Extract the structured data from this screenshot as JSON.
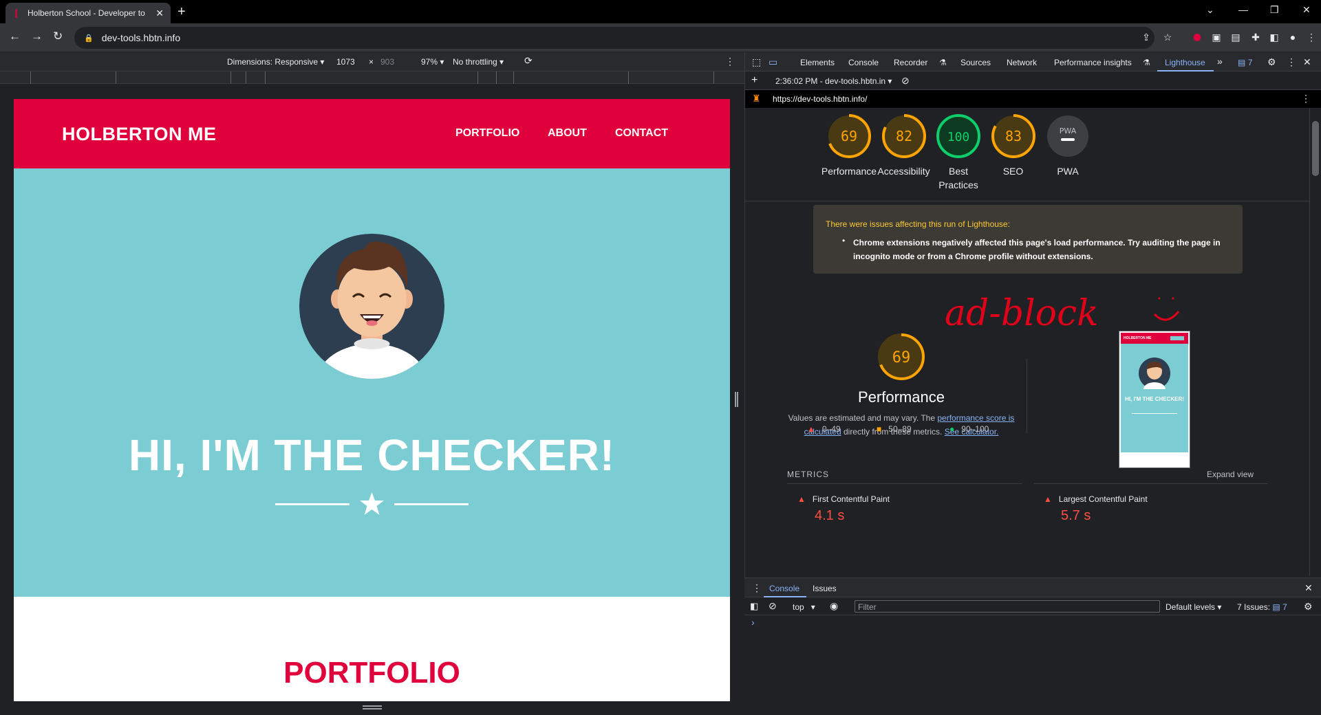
{
  "browser": {
    "tab_title": "Holberton School - Developer to",
    "tab_close": "✕",
    "new_tab": "+",
    "url": "dev-tools.hbtn.info"
  },
  "device_toolbar": {
    "dimensions_label": "Dimensions: Responsive",
    "width": "1073",
    "times": "×",
    "height": "903",
    "zoom": "97%",
    "throttling": "No throttling"
  },
  "page": {
    "brand": "HOLBERTON ME",
    "nav": [
      "PORTFOLIO",
      "ABOUT",
      "CONTACT"
    ],
    "hero_title": "HI, I'M THE CHECKER!",
    "section_title": "PORTFOLIO",
    "colors": {
      "brand_red": "#e0003c",
      "hero_teal": "#7ccdd3"
    }
  },
  "devtools": {
    "tabs": [
      "Elements",
      "Console",
      "Recorder",
      "Sources",
      "Network",
      "Performance insights",
      "Lighthouse"
    ],
    "active_tab": "Lighthouse",
    "more": "»",
    "issues_count": "7",
    "report_selector": "2:36:02 PM - dev-tools.hbtn.in",
    "report_url": "https://dev-tools.hbtn.info/",
    "scores": [
      {
        "label": "Performance",
        "value": "69",
        "color": "#ffa400",
        "fraction": 0.69
      },
      {
        "label": "Accessibility",
        "value": "82",
        "color": "#ffa400",
        "fraction": 0.82
      },
      {
        "label": "Best Practices",
        "value": "100",
        "color": "#0cce6b",
        "fraction": 1.0
      },
      {
        "label": "SEO",
        "value": "83",
        "color": "#ffa400",
        "fraction": 0.83
      },
      {
        "label": "PWA",
        "value": "PWA",
        "color": "#9aa0a6",
        "fraction": 0
      }
    ],
    "issues_heading": "There were issues affecting this run of Lighthouse:",
    "issues_item": "Chrome extensions negatively affected this page's load performance. Try auditing the page in incognito mode or from a Chrome profile without extensions.",
    "annotation": "ad-block",
    "perf": {
      "score": "69",
      "title": "Performance",
      "desc_1": "Values are estimated and may vary. The ",
      "link_1": "performance score is calculated",
      "desc_2": " directly from these metrics. ",
      "link_2": "See calculator."
    },
    "legend": [
      "0–49",
      "50–89",
      "90–100"
    ],
    "metrics_heading": "METRICS",
    "expand_view": "Expand view",
    "metrics": [
      {
        "name": "First Contentful Paint",
        "value": "4.1 s"
      },
      {
        "name": "Largest Contentful Paint",
        "value": "5.7 s"
      }
    ],
    "thumb": {
      "brand": "HOLBERTON ME",
      "title": "HI, I'M THE CHECKER!"
    }
  },
  "console_drawer": {
    "tabs": [
      "Console",
      "Issues"
    ],
    "context": "top",
    "filter_placeholder": "Filter",
    "levels": "Default levels",
    "issues_label": "7 Issues:",
    "issues_count": "7",
    "prompt": "›"
  }
}
